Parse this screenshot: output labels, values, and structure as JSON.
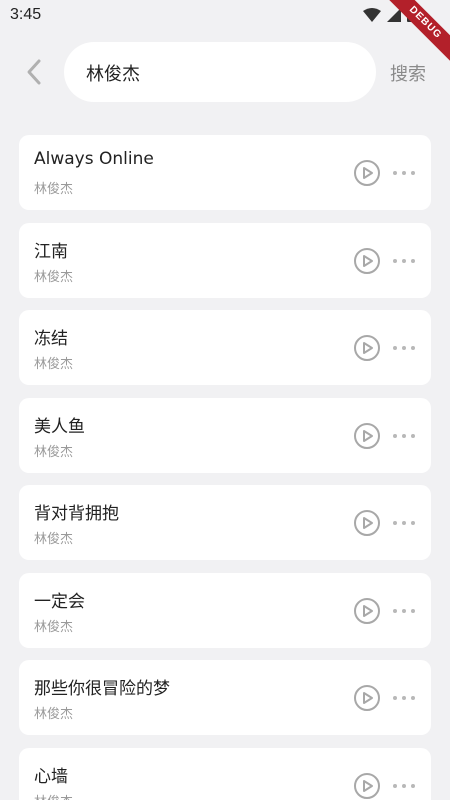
{
  "status_bar": {
    "time": "3:45",
    "debug_label": "DEBUG"
  },
  "search": {
    "query": "林俊杰",
    "button_label": "搜索"
  },
  "songs": [
    {
      "title": "Always Online",
      "artist": "林俊杰"
    },
    {
      "title": "江南",
      "artist": "林俊杰"
    },
    {
      "title": "冻结",
      "artist": "林俊杰"
    },
    {
      "title": "美人鱼",
      "artist": "林俊杰"
    },
    {
      "title": "背对背拥抱",
      "artist": "林俊杰"
    },
    {
      "title": "一定会",
      "artist": "林俊杰"
    },
    {
      "title": "那些你很冒险的梦",
      "artist": "林俊杰"
    },
    {
      "title": "心墙",
      "artist": "林俊杰"
    }
  ],
  "icons": {
    "back": "chevron-left-icon",
    "play": "play-circle-icon",
    "more": "more-horizontal-icon"
  },
  "colors": {
    "background": "#f1f1f3",
    "card": "#ffffff",
    "debug_ribbon": "#b3202a"
  }
}
